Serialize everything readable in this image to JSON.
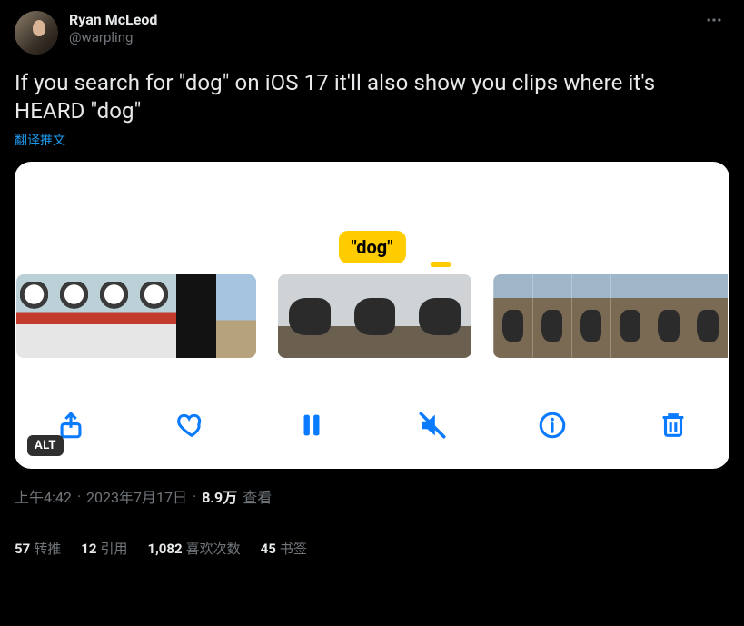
{
  "author": {
    "display_name": "Ryan McLeod",
    "handle": "@warpling"
  },
  "tweet_text": "If you search for \"dog\" on iOS 17 it'll also show you clips where it's HEARD \"dog\"",
  "translate_label": "翻译推文",
  "media": {
    "tooltip": "\"dog\"",
    "alt_badge": "ALT"
  },
  "meta": {
    "time": "上午4:42",
    "date": "2023年7月17日",
    "views_number": "8.9万",
    "views_label": "查看"
  },
  "stats": {
    "retweets": {
      "count": "57",
      "label": "转推"
    },
    "quotes": {
      "count": "12",
      "label": "引用"
    },
    "likes": {
      "count": "1,082",
      "label": "喜欢次数"
    },
    "bookmarks": {
      "count": "45",
      "label": "书签"
    }
  }
}
